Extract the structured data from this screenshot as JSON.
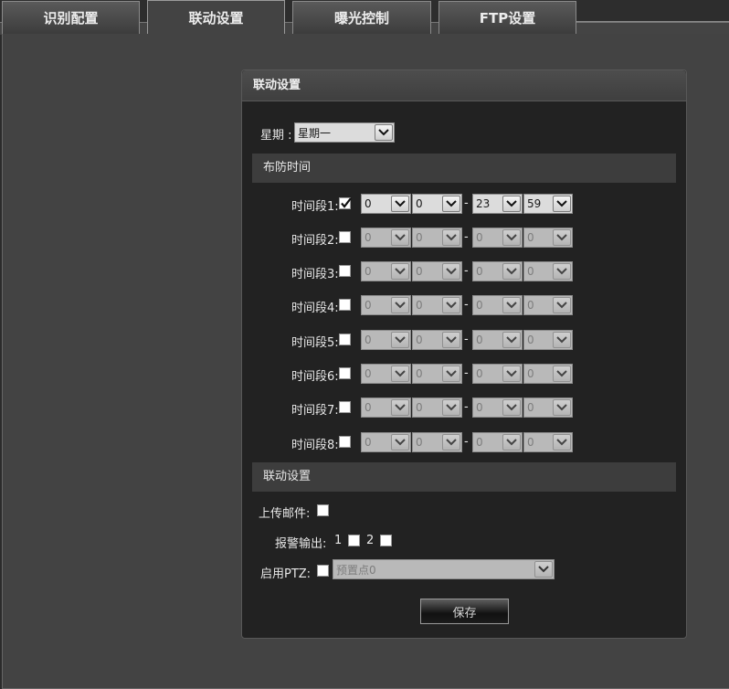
{
  "tabs": [
    {
      "label": "识别配置",
      "active": false
    },
    {
      "label": "联动设置",
      "active": true
    },
    {
      "label": "曝光控制",
      "active": false
    },
    {
      "label": "FTP设置",
      "active": false
    }
  ],
  "panel": {
    "title": "联动设置",
    "weekday_label": "星期 :",
    "weekday_value": "星期一",
    "section_schedule": "布防时间",
    "section_linkage": "联动设置",
    "segments": [
      {
        "label": "时间段1:",
        "enabled": true,
        "start_h": "0",
        "start_m": "0",
        "end_h": "23",
        "end_m": "59"
      },
      {
        "label": "时间段2:",
        "enabled": false,
        "start_h": "0",
        "start_m": "0",
        "end_h": "0",
        "end_m": "0"
      },
      {
        "label": "时间段3:",
        "enabled": false,
        "start_h": "0",
        "start_m": "0",
        "end_h": "0",
        "end_m": "0"
      },
      {
        "label": "时间段4:",
        "enabled": false,
        "start_h": "0",
        "start_m": "0",
        "end_h": "0",
        "end_m": "0"
      },
      {
        "label": "时间段5:",
        "enabled": false,
        "start_h": "0",
        "start_m": "0",
        "end_h": "0",
        "end_m": "0"
      },
      {
        "label": "时间段6:",
        "enabled": false,
        "start_h": "0",
        "start_m": "0",
        "end_h": "0",
        "end_m": "0"
      },
      {
        "label": "时间段7:",
        "enabled": false,
        "start_h": "0",
        "start_m": "0",
        "end_h": "0",
        "end_m": "0"
      },
      {
        "label": "时间段8:",
        "enabled": false,
        "start_h": "0",
        "start_m": "0",
        "end_h": "0",
        "end_m": "0"
      }
    ],
    "dash": "-",
    "upload_mail_label": "上传邮件:",
    "alarm_output_label": "报警输出:",
    "alarm_output_1": "1",
    "alarm_output_2": "2",
    "ptz_label": "启用PTZ:",
    "ptz_preset": "预置点0",
    "save_label": "保存"
  }
}
